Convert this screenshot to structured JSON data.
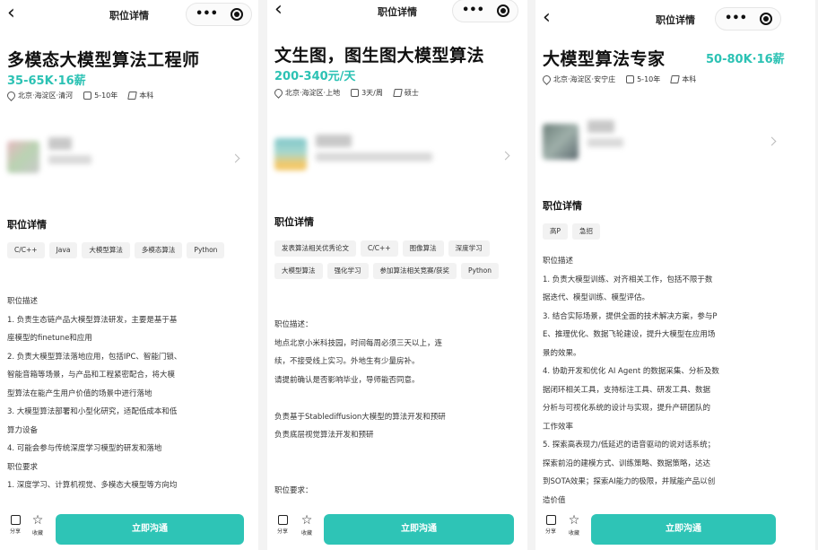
{
  "common": {
    "nav_title": "职位详情",
    "more": "•••",
    "section_title": "职位详情",
    "share_label": "分享",
    "favorite_label": "收藏",
    "cta_label": "立即沟通",
    "accent_color": "#2ec4b6"
  },
  "panels": [
    {
      "job_title": "多模态大模型算法工程师",
      "salary": "35-65K·16薪",
      "location": "北京·海淀区·清河",
      "experience": "5-10年",
      "education": "本科",
      "tags": [
        "C/C++",
        "Java",
        "大模型算法",
        "多模态算法",
        "Python"
      ],
      "description": [
        "职位描述",
        "1. 负责生态链产品大模型算法研发，主要是基于基",
        "座模型的finetune和应用",
        "2. 负责大模型算法落地应用，包括IPC、智能门锁、",
        "智能音箱等场景，与产品和工程紧密配合，将大模",
        "型算法在能产生用户价值的场景中进行落地",
        "3. 大模型算法部署和小型化研究，适配低成本和低",
        "算力设备",
        "4. 可能会参与传统深度学习模型的研发和落地",
        "职位要求",
        "1. 深度学习、计算机视觉、多模态大模型等方向均"
      ]
    },
    {
      "job_title": "文生图，图生图大模型算法",
      "salary": "200-340元/天",
      "location": "北京·海淀区·上地",
      "experience": "3天/周",
      "education": "硕士",
      "tags": [
        "发表算法相关优秀论文",
        "C/C++",
        "图像算法",
        "深度学习",
        "大模型算法",
        "强化学习",
        "参加算法相关竞赛/获奖",
        "Python"
      ],
      "description": [
        "职位描述：",
        "地点北京小米科技园，时间每周必须三天以上，连",
        "续，不接受线上实习。外地生有少量房补。",
        "请提前确认是否影响毕业，导师能否同意。",
        "",
        "负责基于Stablediffusion大模型的算法开发和预研",
        "负责底层视觉算法开发和预研",
        "",
        "",
        "职位要求："
      ]
    },
    {
      "job_title": "大模型算法专家",
      "salary": "50-80K·16薪",
      "location": "北京·海淀区·安宁庄",
      "experience": "5-10年",
      "education": "本科",
      "tags": [
        "高P",
        "急招"
      ],
      "description": [
        "职位描述",
        "1. 负责大模型训练、对齐相关工作，包括不限于数",
        "据迭代、模型训练、模型评估。",
        "3. 结合实际场景，提供全面的技术解决方案，参与P",
        "E、推理优化、数据飞轮建设，提升大模型在应用场",
        "景的效果。",
        "4. 协助开发和优化 AI Agent 的数据采集、分析及数",
        "据闭环相关工具，支持标注工具、研发工具、数据",
        "分析与可视化系统的设计与实现，提升产研团队的",
        "工作效率",
        "5. 探索高表现力/低延迟的语音驱动的说对话系统；",
        "探索前沿的建模方式、训练策略、数据策略，达达",
        "到SOTA效果；探索AI能力的极限，并赋能产品以创",
        "造价值"
      ]
    }
  ]
}
